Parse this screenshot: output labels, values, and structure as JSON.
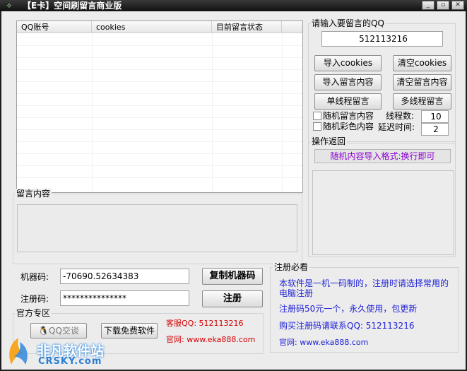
{
  "window": {
    "title": "【E卡】空间刷留言商业版",
    "minimize_glyph": "_",
    "maximize_glyph": "▫",
    "close_glyph": "✕"
  },
  "table": {
    "columns": [
      "QQ账号",
      "cookies",
      "目前留言状态"
    ]
  },
  "qq_input": {
    "label": "请输入要留言的QQ",
    "value": "512113216"
  },
  "buttons": {
    "import_cookies": "导入cookies",
    "clear_cookies": "清空cookies",
    "import_content": "导入留言内容",
    "clear_content": "清空留言内容",
    "single_thread": "单线程留言",
    "multi_thread": "多线程留言",
    "copy_machine_code": "复制机器码",
    "register": "注册",
    "qq_chat": "QQ交谈",
    "download_free": "下载免费软件"
  },
  "options": {
    "random_content": "随机留言内容",
    "random_color": "随机彩色内容",
    "thread_label": "线程数:",
    "thread_value": "10",
    "delay_label": "延迟时间:",
    "delay_value": "2"
  },
  "operation": {
    "label": "操作返回",
    "message": "随机内容导入格式:换行即可"
  },
  "message_content": {
    "label": "留言内容"
  },
  "machine": {
    "label": "机器码:",
    "value": "-70690.52634383"
  },
  "registration": {
    "label": "注册码:",
    "value": "***************"
  },
  "official": {
    "label": "官方专区",
    "support_qq": "客服QQ: 512113216",
    "website": "官网: www.eka888.com"
  },
  "notice": {
    "label": "注册必看",
    "line1": "本软件是一机一码制的，注册时请选择常用的电脑注册",
    "line2": "注册码50元一个，永久使用，包更新",
    "line3": "购买注册码请联系QQ: 512113216",
    "line4": "官网: www.eka888.com"
  },
  "watermark": {
    "cn": "非凡软件站",
    "en": "CRSKY.com"
  },
  "colors": {
    "red": "#d40000",
    "blue": "#1f22d6",
    "purple": "#8a00d0",
    "titlebar": "#1a1a1a"
  }
}
